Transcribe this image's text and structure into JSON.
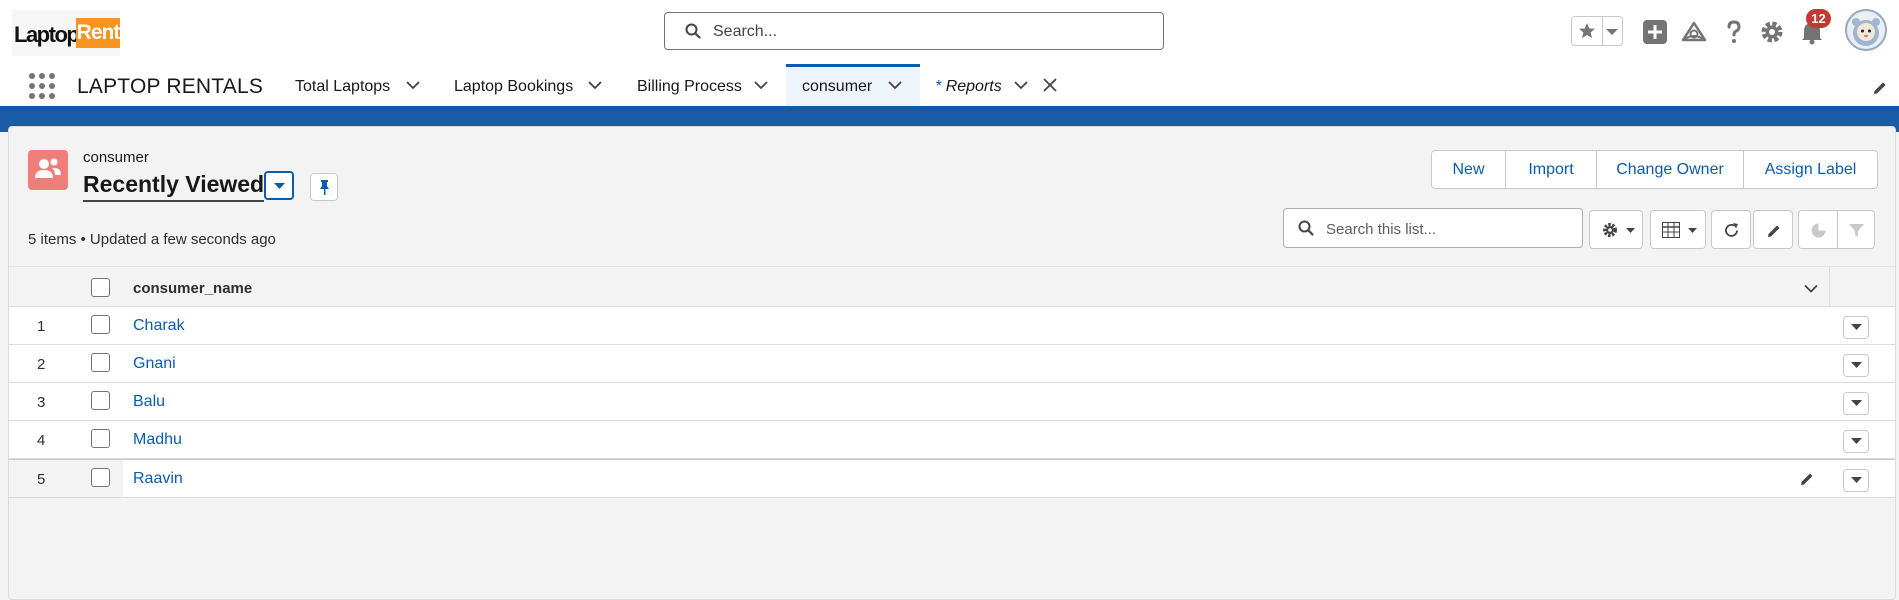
{
  "logo": {
    "part1": "Laptop",
    "part2": "Rent"
  },
  "global_search": {
    "placeholder": "Search..."
  },
  "notifications": {
    "count": "12"
  },
  "nav": {
    "app_name": "LAPTOP RENTALS",
    "tabs": [
      {
        "label": "Total Laptops"
      },
      {
        "label": "Laptop Bookings"
      },
      {
        "label": "Billing Process"
      },
      {
        "label": "consumer",
        "active": true
      },
      {
        "label": "Reports",
        "prefix": "*",
        "italic": true
      }
    ]
  },
  "list_view": {
    "object_name": "consumer",
    "view_name": "Recently Viewed",
    "summary": "5 items • Updated a few seconds ago",
    "actions": [
      "New",
      "Import",
      "Change Owner",
      "Assign Label"
    ],
    "search_placeholder": "Search this list...",
    "column": "consumer_name",
    "rows": [
      {
        "num": "1",
        "name": "Charak"
      },
      {
        "num": "2",
        "name": "Gnani"
      },
      {
        "num": "3",
        "name": "Balu"
      },
      {
        "num": "4",
        "name": "Madhu"
      },
      {
        "num": "5",
        "name": "Raavin"
      }
    ]
  },
  "colors": {
    "brand": "#0b5cab",
    "object_icon": "#ef7d79",
    "badge": "#c23934",
    "logo_accent": "#f7931e"
  }
}
